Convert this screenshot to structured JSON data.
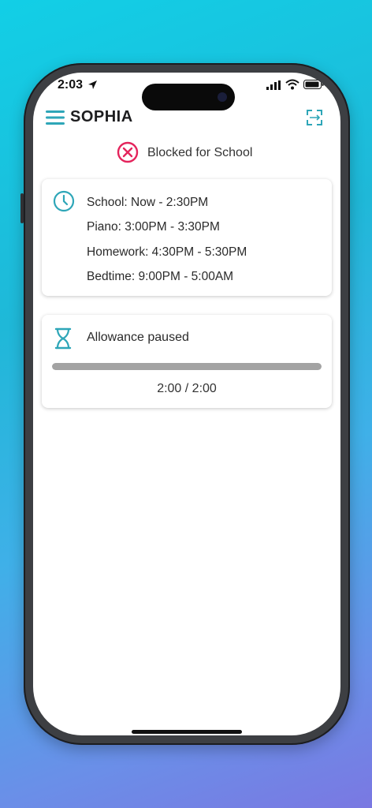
{
  "status_bar": {
    "time": "2:03"
  },
  "header": {
    "title": "SOPHIA"
  },
  "blocked": {
    "label": "Blocked for School",
    "color": "#e4245c"
  },
  "schedule": {
    "items": [
      {
        "label": "School: Now - 2:30PM"
      },
      {
        "label": "Piano: 3:00PM - 3:30PM"
      },
      {
        "label": "Homework: 4:30PM - 5:30PM"
      },
      {
        "label": "Bedtime: 9:00PM - 5:00AM"
      }
    ]
  },
  "allowance": {
    "label": "Allowance paused",
    "count": "2:00 / 2:00",
    "fraction": 1.0
  },
  "colors": {
    "accent": "#2ea6b8",
    "alert": "#e4245c"
  },
  "icons": {
    "menu": "menu-icon",
    "switch": "switch-device-icon",
    "blocked": "x-circle-icon",
    "clock": "clock-icon",
    "allowance": "hourglass-icon"
  }
}
